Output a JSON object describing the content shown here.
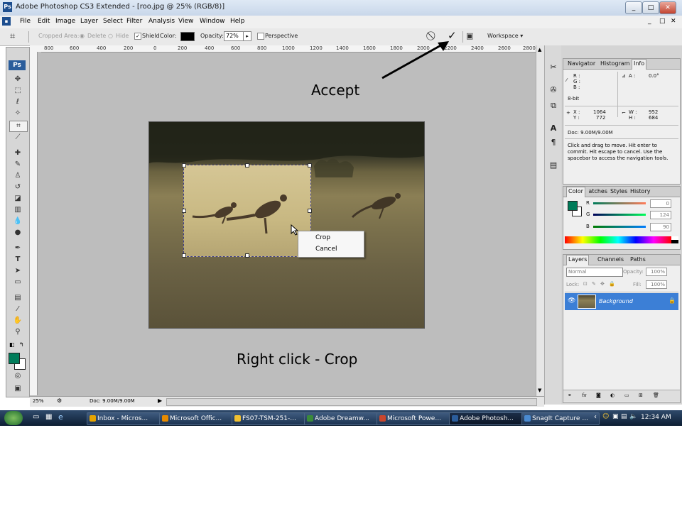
{
  "window": {
    "title": "Adobe Photoshop CS3 Extended - [roo.jpg @ 25% (RGB/8)]",
    "app_icon": "Ps",
    "controls": [
      "_",
      "□",
      "✕"
    ],
    "doc_controls": [
      "_",
      "□",
      "✕"
    ]
  },
  "menu": [
    "File",
    "Edit",
    "Image",
    "Layer",
    "Select",
    "Filter",
    "Analysis",
    "View",
    "Window",
    "Help"
  ],
  "options_bar": {
    "cropped_area_label": "Cropped Area:",
    "delete_label": "Delete",
    "hide_label": "Hide",
    "shield_label": "Shield",
    "color_label": "Color:",
    "opacity_label": "Opacity:",
    "opacity_value": "72%",
    "perspective_label": "Perspective",
    "workspace_label": "Workspace ▾"
  },
  "ruler_labels": [
    "800",
    "600",
    "400",
    "200",
    "0",
    "200",
    "400",
    "600",
    "800",
    "1000",
    "1200",
    "1400",
    "1600",
    "1800",
    "2000",
    "2200",
    "2400",
    "2600",
    "2800"
  ],
  "context_menu": [
    "Crop",
    "Cancel"
  ],
  "callouts": {
    "accept": "Accept",
    "right_click": "Right click - Crop"
  },
  "status": {
    "zoom": "25%",
    "doc": "Doc: 9.00M/9.00M"
  },
  "info_panel": {
    "tabs": [
      "Navigator",
      "Histogram",
      "Info"
    ],
    "rgb_labels": [
      "R :",
      "G :",
      "B :"
    ],
    "bit": "8-bit",
    "angle_label": "A :",
    "angle_value": "0.0°",
    "x_label": "X :",
    "x_value": "1064",
    "y_label": "Y :",
    "y_value": "772",
    "w_label": "W :",
    "w_value": "952",
    "h_label": "H :",
    "h_value": "684",
    "doc": "Doc: 9.00M/9.00M",
    "hint": "Click and drag to move. Hit enter to commit. Hit escape to cancel. Use the spacebar to access the navigation tools."
  },
  "color_panel": {
    "tabs": [
      "Color",
      "Swatches",
      "Styles",
      "History"
    ],
    "r_label": "R",
    "r_value": "0",
    "g_label": "G",
    "g_value": "124",
    "b_label": "B",
    "b_value": "90",
    "fg_color": "#007c5a"
  },
  "layers_panel": {
    "tabs": [
      "Layers",
      "Channels",
      "Paths"
    ],
    "blend_mode": "Normal",
    "opacity_label": "Opacity:",
    "opacity_value": "100%",
    "lock_label": "Lock:",
    "fill_label": "Fill:",
    "fill_value": "100%",
    "layer_name": "Background"
  },
  "taskbar": {
    "items": [
      {
        "label": "Inbox - Micros...",
        "color": "#e6a400"
      },
      {
        "label": "Microsoft Offic...",
        "color": "#e68a00"
      },
      {
        "label": "FS07-TSM-251-...",
        "color": "#f0c030"
      },
      {
        "label": "Adobe Dreamw...",
        "color": "#3a8a3a"
      },
      {
        "label": "Microsoft Powe...",
        "color": "#c8462d"
      },
      {
        "label": "Adobe Photosh...",
        "color": "#2b5d9b"
      },
      {
        "label": "SnagIt Capture ...",
        "color": "#4a8ad0"
      }
    ],
    "time": "12:34 AM"
  }
}
